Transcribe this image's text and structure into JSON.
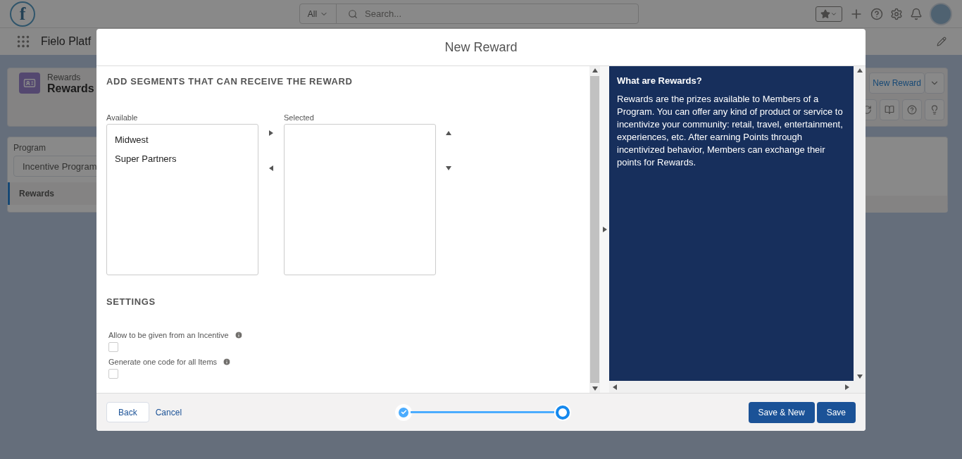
{
  "app_header": {
    "logo": "f",
    "search_scope": "All",
    "search_placeholder": "Search..."
  },
  "nav": {
    "app_name": "Fielo Platf"
  },
  "page_header": {
    "object_label": "Rewards",
    "title": "Rewards",
    "action": "New Reward"
  },
  "sidebar": {
    "program_label": "Program",
    "program_value": "Incentive Program",
    "tabs": [
      {
        "label": "Rewards",
        "selected": true
      }
    ]
  },
  "modal": {
    "title": "New Reward",
    "segments": {
      "heading": "ADD SEGMENTS THAT CAN RECEIVE THE REWARD",
      "available_label": "Available",
      "available_items": [
        "Midwest",
        "Super Partners"
      ],
      "selected_label": "Selected"
    },
    "settings": {
      "heading": "SETTINGS",
      "options": [
        {
          "label": "Allow to be given from an Incentive",
          "checked": false
        },
        {
          "label": "Generate one code for all Items",
          "checked": false
        }
      ]
    },
    "help": {
      "title": "What are Rewards?",
      "body": "Rewards are the prizes available to Members of a Program. You can offer any kind of product or service to incentivize your community: retail, travel, entertainment, experiences, etc. After earning Points through incentivized behavior, Members can exchange their points for Rewards."
    },
    "footer": {
      "back": "Back",
      "cancel": "Cancel",
      "steps": [
        {
          "done": true
        },
        {
          "done": false
        }
      ],
      "buttons": [
        "Save & New",
        "Save"
      ]
    }
  }
}
